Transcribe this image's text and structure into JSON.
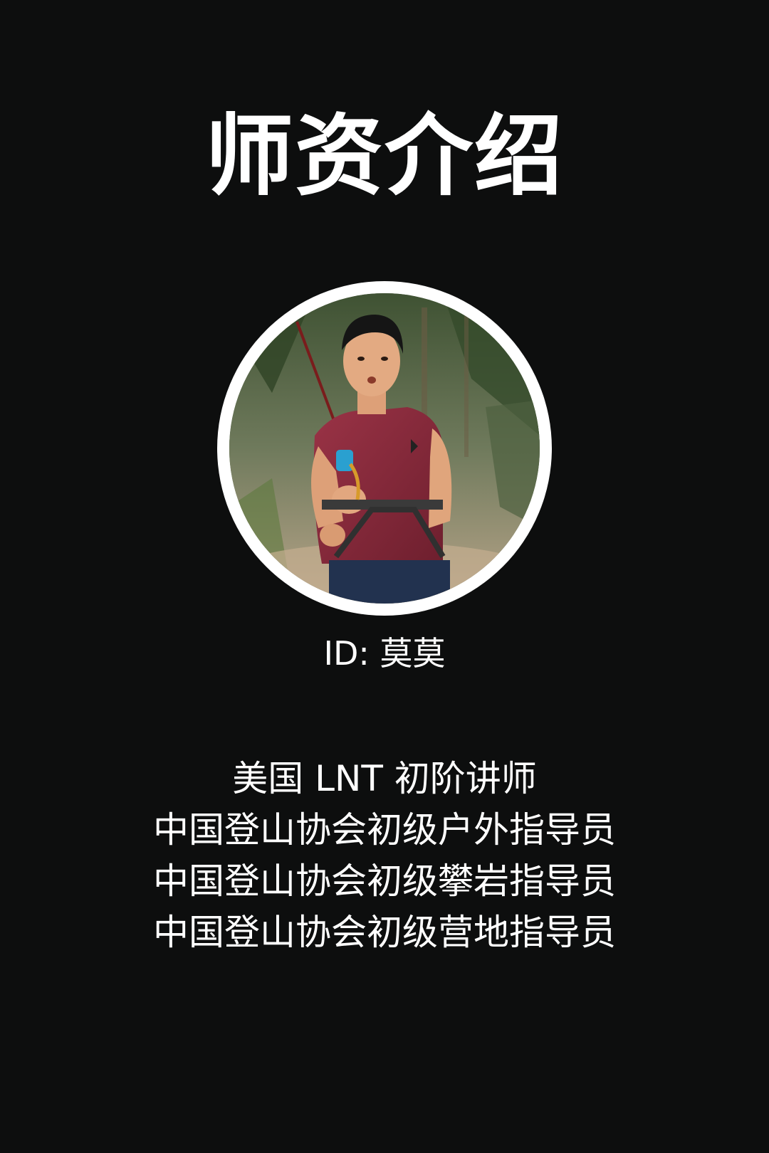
{
  "header": {
    "title": "师资介绍"
  },
  "profile": {
    "id_text": "ID: 莫莫",
    "avatar_icon": "climber-portrait-photo"
  },
  "credentials": [
    "美国 LNT 初阶讲师",
    "中国登山协会初级户外指导员",
    "中国登山协会初级攀岩指导员",
    "中国登山协会初级营地指导员"
  ],
  "colors": {
    "background": "#0d0e0e",
    "text": "#ffffff",
    "ring": "#ffffff",
    "shirt": "#8a2b3c"
  }
}
